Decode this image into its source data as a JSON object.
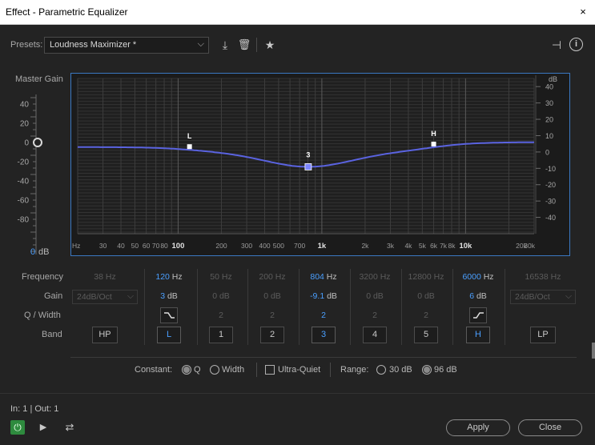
{
  "window": {
    "title": "Effect - Parametric Equalizer",
    "close_glyph": "×"
  },
  "presets": {
    "label": "Presets:",
    "value": "Loudness Maximizer *",
    "chevron": "⌵"
  },
  "toolbar": {
    "save_glyph": "⤓",
    "delete_glyph": "🗑",
    "favorite_glyph": "★",
    "route_glyph": "⊣",
    "info_glyph": "i"
  },
  "master_gain": {
    "label": "Master Gain",
    "value": "0",
    "unit": "dB",
    "ticks": [
      "40",
      "20",
      "0",
      "-20",
      "-40",
      "-60",
      "-80"
    ]
  },
  "graph": {
    "db_unit": "dB",
    "db_ticks": [
      "40",
      "30",
      "20",
      "10",
      "0",
      "-10",
      "-20",
      "-30",
      "-40"
    ],
    "freq_ticks": [
      "Hz",
      "30",
      "40",
      "50",
      "60",
      "70",
      "80",
      "100",
      "200",
      "300",
      "400",
      "500",
      "700",
      "1k",
      "2k",
      "3k",
      "4k",
      "5k",
      "6k",
      "7k",
      "8k",
      "10k",
      "20k",
      "30k"
    ],
    "nodes": [
      {
        "label": "L",
        "freq": 120,
        "gain": 3
      },
      {
        "label": "3",
        "freq": 804,
        "gain": -9.1
      },
      {
        "label": "H",
        "freq": 6000,
        "gain": 6
      }
    ],
    "curve_color": "#5a63e0",
    "selected_color": "#7d86ff"
  },
  "bands": {
    "row_labels": {
      "frequency": "Frequency",
      "gain": "Gain",
      "q": "Q / Width",
      "band": "Band"
    },
    "hz_unit": "Hz",
    "db_unit": "dB",
    "columns": [
      {
        "name": "HP",
        "freq": "38",
        "gain": "24dB/Oct",
        "q": "",
        "active": false,
        "kind": "slope"
      },
      {
        "name": "L",
        "freq": "120",
        "gain": "3",
        "q": "",
        "active": true,
        "kind": "shelf-low"
      },
      {
        "name": "1",
        "freq": "50",
        "gain": "0",
        "q": "2",
        "active": false,
        "kind": "peak"
      },
      {
        "name": "2",
        "freq": "200",
        "gain": "0",
        "q": "2",
        "active": false,
        "kind": "peak"
      },
      {
        "name": "3",
        "freq": "804",
        "gain": "-9.1",
        "q": "2",
        "active": true,
        "kind": "peak"
      },
      {
        "name": "4",
        "freq": "3200",
        "gain": "0",
        "q": "2",
        "active": false,
        "kind": "peak"
      },
      {
        "name": "5",
        "freq": "12800",
        "gain": "0",
        "q": "2",
        "active": false,
        "kind": "peak"
      },
      {
        "name": "H",
        "freq": "6000",
        "gain": "6",
        "q": "",
        "active": true,
        "kind": "shelf-high"
      },
      {
        "name": "LP",
        "freq": "16538",
        "gain": "24dB/Oct",
        "q": "",
        "active": false,
        "kind": "slope"
      }
    ]
  },
  "options": {
    "constant_label": "Constant:",
    "q_label": "Q",
    "width_label": "Width",
    "ultra_quiet_label": "Ultra-Quiet",
    "range_label": "Range:",
    "range_30": "30 dB",
    "range_96": "96 dB"
  },
  "footer": {
    "io": "In: 1 | Out: 1",
    "apply_label": "Apply",
    "close_label": "Close",
    "power_glyph": "⏻",
    "play_glyph": "▶",
    "loop_glyph": "⇄"
  }
}
